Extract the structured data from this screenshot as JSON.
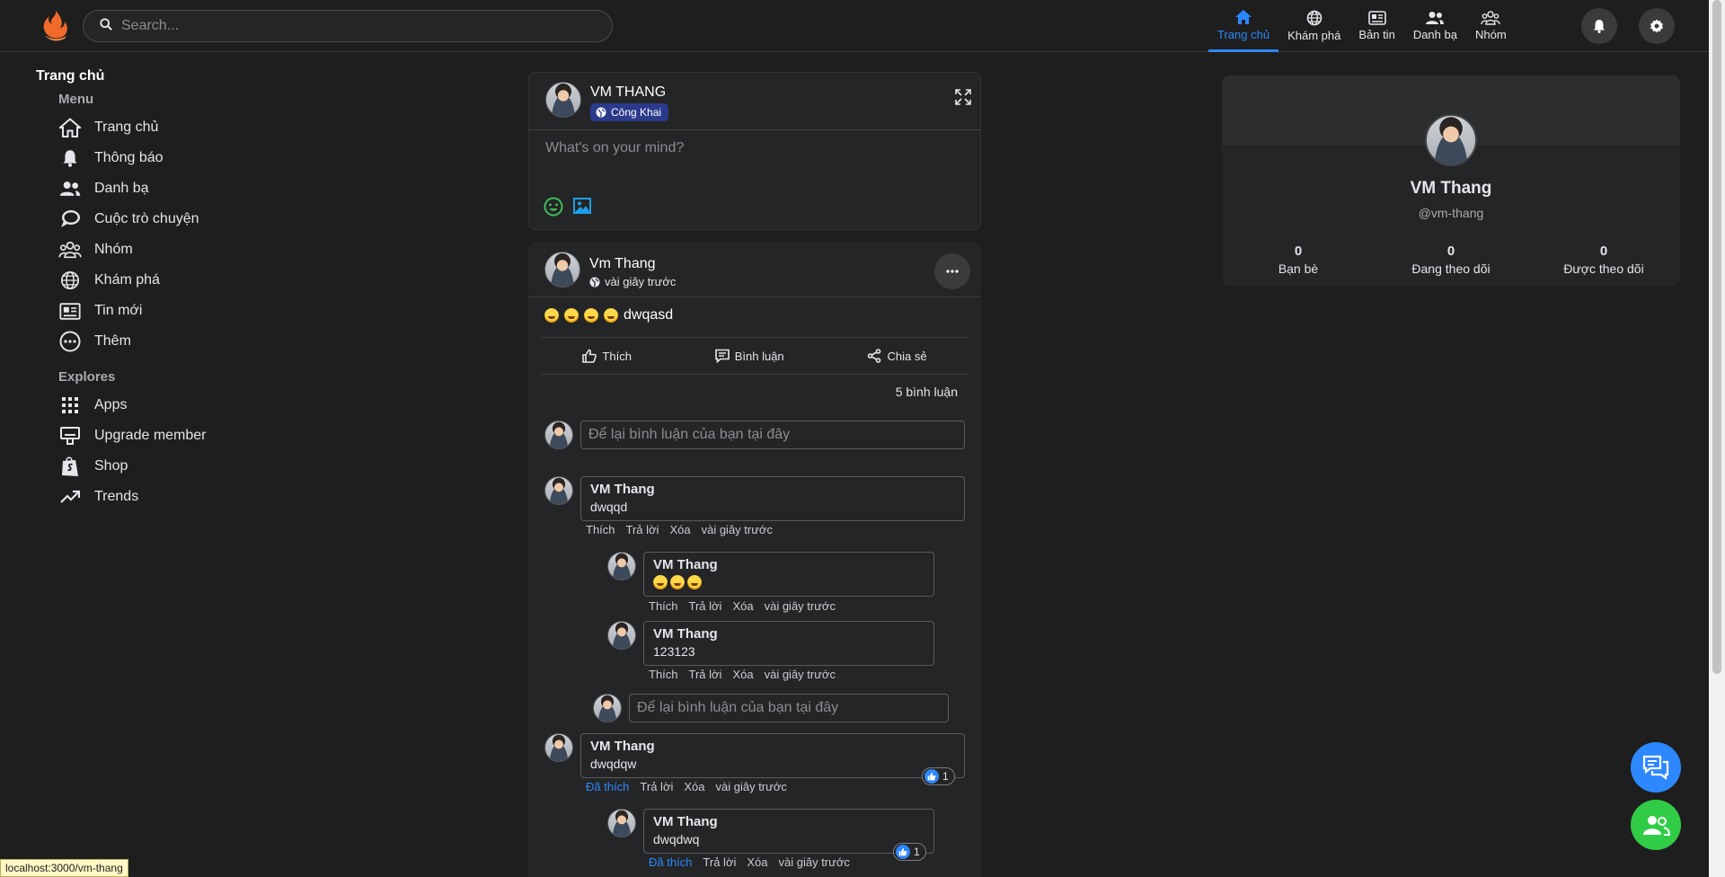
{
  "topbar": {
    "search_placeholder": "Search...",
    "tabs": [
      {
        "label": "Trang chủ",
        "icon": "home-icon",
        "active": true
      },
      {
        "label": "Khám phá",
        "icon": "globe-icon"
      },
      {
        "label": "Bản tin",
        "icon": "newspaper-icon"
      },
      {
        "label": "Danh bạ",
        "icon": "contacts-icon"
      },
      {
        "label": "Nhóm",
        "icon": "group-icon"
      }
    ]
  },
  "sidebar": {
    "title": "Trang chủ",
    "menu_heading": "Menu",
    "menu": [
      {
        "label": "Trang chủ",
        "icon": "home-icon"
      },
      {
        "label": "Thông báo",
        "icon": "bell-icon"
      },
      {
        "label": "Danh bạ",
        "icon": "contacts-icon"
      },
      {
        "label": "Cuộc trò chuyện",
        "icon": "chat-icon"
      },
      {
        "label": "Nhóm",
        "icon": "group-icon"
      },
      {
        "label": "Khám phá",
        "icon": "globe-icon"
      },
      {
        "label": "Tin mới",
        "icon": "newspaper-icon"
      },
      {
        "label": "Thêm",
        "icon": "more-circle-icon"
      }
    ],
    "explores_heading": "Explores",
    "explores": [
      {
        "label": "Apps",
        "icon": "apps-grid-icon"
      },
      {
        "label": "Upgrade member",
        "icon": "monitor-icon"
      },
      {
        "label": "Shop",
        "icon": "shop-bag-icon"
      },
      {
        "label": "Trends",
        "icon": "trend-icon"
      }
    ]
  },
  "create_post": {
    "user_name": "VM THANG",
    "privacy": "Công Khai",
    "placeholder": "What's on your mind?"
  },
  "post": {
    "author": "Vm Thang",
    "time": "vài giây trước",
    "content": "dwqasd",
    "like_label": "Thích",
    "comment_label": "Bình luận",
    "share_label": "Chia sẻ",
    "comment_count": "5 bình luận",
    "comment_placeholder": "Để lại bình luận của bạn tại đây",
    "comments": [
      {
        "name": "VM Thang",
        "text": "dwqqd",
        "like": "Thích",
        "reply": "Trả lời",
        "delete": "Xóa",
        "time": "vài giây trước"
      },
      {
        "name": "VM Thang",
        "text": "",
        "like": "Thích",
        "reply": "Trả lời",
        "delete": "Xóa",
        "time": "vài giây trước"
      },
      {
        "name": "VM Thang",
        "text": "123123",
        "like": "Thích",
        "reply": "Trả lời",
        "delete": "Xóa",
        "time": "vài giây trước"
      },
      {
        "name": "VM Thang",
        "text": "dwqdqw",
        "like": "Đã thích",
        "reply": "Trả lời",
        "delete": "Xóa",
        "time": "vài giây trước",
        "likes": "1"
      },
      {
        "name": "VM Thang",
        "text": "dwqdwq",
        "like": "Đã thích",
        "reply": "Trả lời",
        "delete": "Xóa",
        "time": "vài giây trước",
        "likes": "1"
      }
    ]
  },
  "profile": {
    "name": "VM Thang",
    "handle": "@vm-thang",
    "stats": [
      {
        "value": "0",
        "label": "Bạn bè"
      },
      {
        "value": "0",
        "label": "Đang theo dõi"
      },
      {
        "value": "0",
        "label": "Được theo dõi"
      }
    ]
  },
  "status_url": "localhost:3000/vm-thang",
  "colors": {
    "accent": "#2d88ff",
    "background": "#1e1e1e",
    "card": "#242526",
    "chat_fab": "#2d88ff",
    "contacts_fab": "#31cc46"
  }
}
